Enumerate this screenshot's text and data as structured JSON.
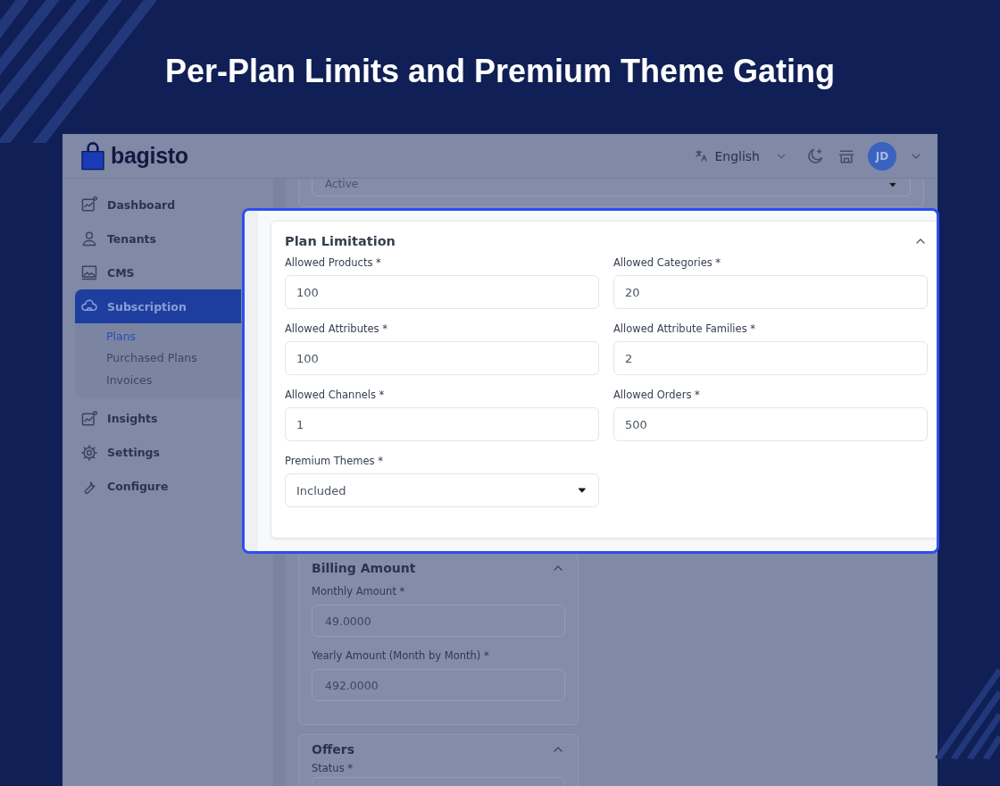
{
  "headline": "Per-Plan Limits and Premium Theme Gating",
  "app": {
    "logo": "bagisto",
    "header": {
      "language": "English",
      "avatar": "JD"
    },
    "sidebar": [
      {
        "label": "Dashboard",
        "selected": false
      },
      {
        "label": "Tenants",
        "selected": false
      },
      {
        "label": "CMS",
        "selected": false
      },
      {
        "label": "Subscription",
        "selected": true,
        "expanded": true,
        "children": [
          {
            "label": "Plans",
            "selected": true
          },
          {
            "label": "Purchased Plans",
            "selected": false
          },
          {
            "label": "Invoices",
            "selected": false
          }
        ]
      },
      {
        "label": "Insights",
        "selected": false
      },
      {
        "label": "Settings",
        "selected": false
      },
      {
        "label": "Configure",
        "selected": false
      }
    ],
    "status_select": {
      "value": "Active"
    },
    "plan_limitation": {
      "title": "Plan Limitation",
      "fields": [
        {
          "label": "Allowed Products *",
          "value": "100",
          "kind": "text"
        },
        {
          "label": "Allowed Categories *",
          "value": "20",
          "kind": "text"
        },
        {
          "label": "Allowed Attributes *",
          "value": "100",
          "kind": "text"
        },
        {
          "label": "Allowed Attribute Families *",
          "value": "2",
          "kind": "text"
        },
        {
          "label": "Allowed Channels *",
          "value": "1",
          "kind": "text"
        },
        {
          "label": "Allowed Orders *",
          "value": "500",
          "kind": "text"
        },
        {
          "label": "Premium Themes *",
          "value": "Included",
          "kind": "select"
        }
      ]
    },
    "billing_amount": {
      "title": "Billing Amount",
      "fields": [
        {
          "label": "Monthly Amount *",
          "value": "49.0000",
          "kind": "text"
        },
        {
          "label": "Yearly Amount (Month by Month) *",
          "value": "492.0000",
          "kind": "text"
        }
      ]
    },
    "offers": {
      "title": "Offers",
      "fields": [
        {
          "label": "Status *",
          "kind": "text"
        }
      ]
    }
  }
}
